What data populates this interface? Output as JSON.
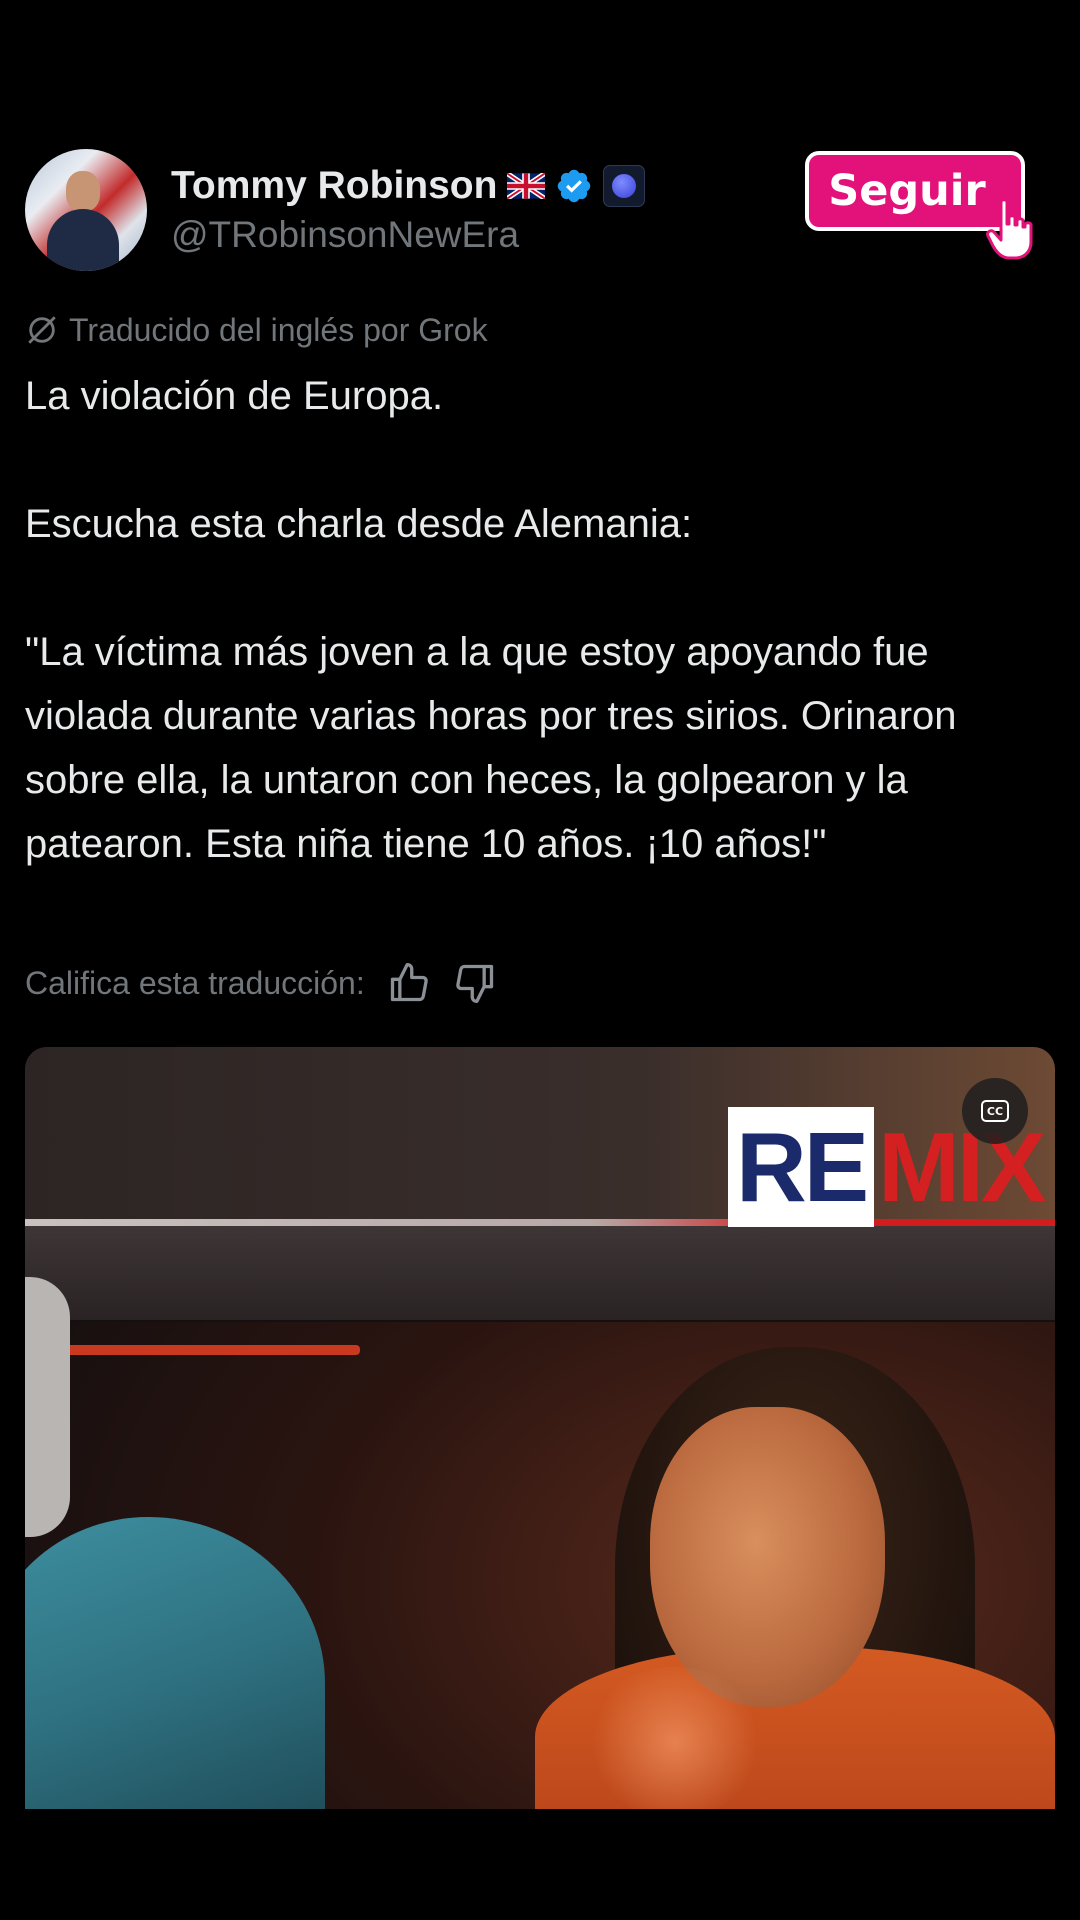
{
  "author": {
    "name": "Tommy Robinson",
    "handle": "@TRobinsonNewEra",
    "flag_icon": "uk-flag-icon",
    "verified_icon": "verified-badge-icon",
    "org_badge_icon": "affiliate-badge-icon"
  },
  "follow_button": {
    "label": "Seguir",
    "color": "#e2127a"
  },
  "translation": {
    "note": "Traducido del inglés por Grok",
    "icon": "grok-icon"
  },
  "tweet": {
    "paragraphs": [
      "La violación de Europa.",
      "Escucha esta charla desde Alemania:",
      "\"La víctima más joven a la que estoy apoyando fue violada durante varias horas por tres sirios. Orinaron sobre ella, la untaron con heces, la golpearon y la patearon. Esta niña tiene 10 años. ¡10 años!\""
    ]
  },
  "rating": {
    "label": "Califica esta traducción:",
    "like_icon": "thumbs-up-icon",
    "dislike_icon": "thumbs-down-icon"
  },
  "video": {
    "logo_left": "RE",
    "logo_right": "MIX",
    "cc_label": "CC"
  },
  "colors": {
    "background": "#000000",
    "text": "#e7e9ea",
    "muted": "#71767b",
    "verified": "#1d9bf0"
  }
}
